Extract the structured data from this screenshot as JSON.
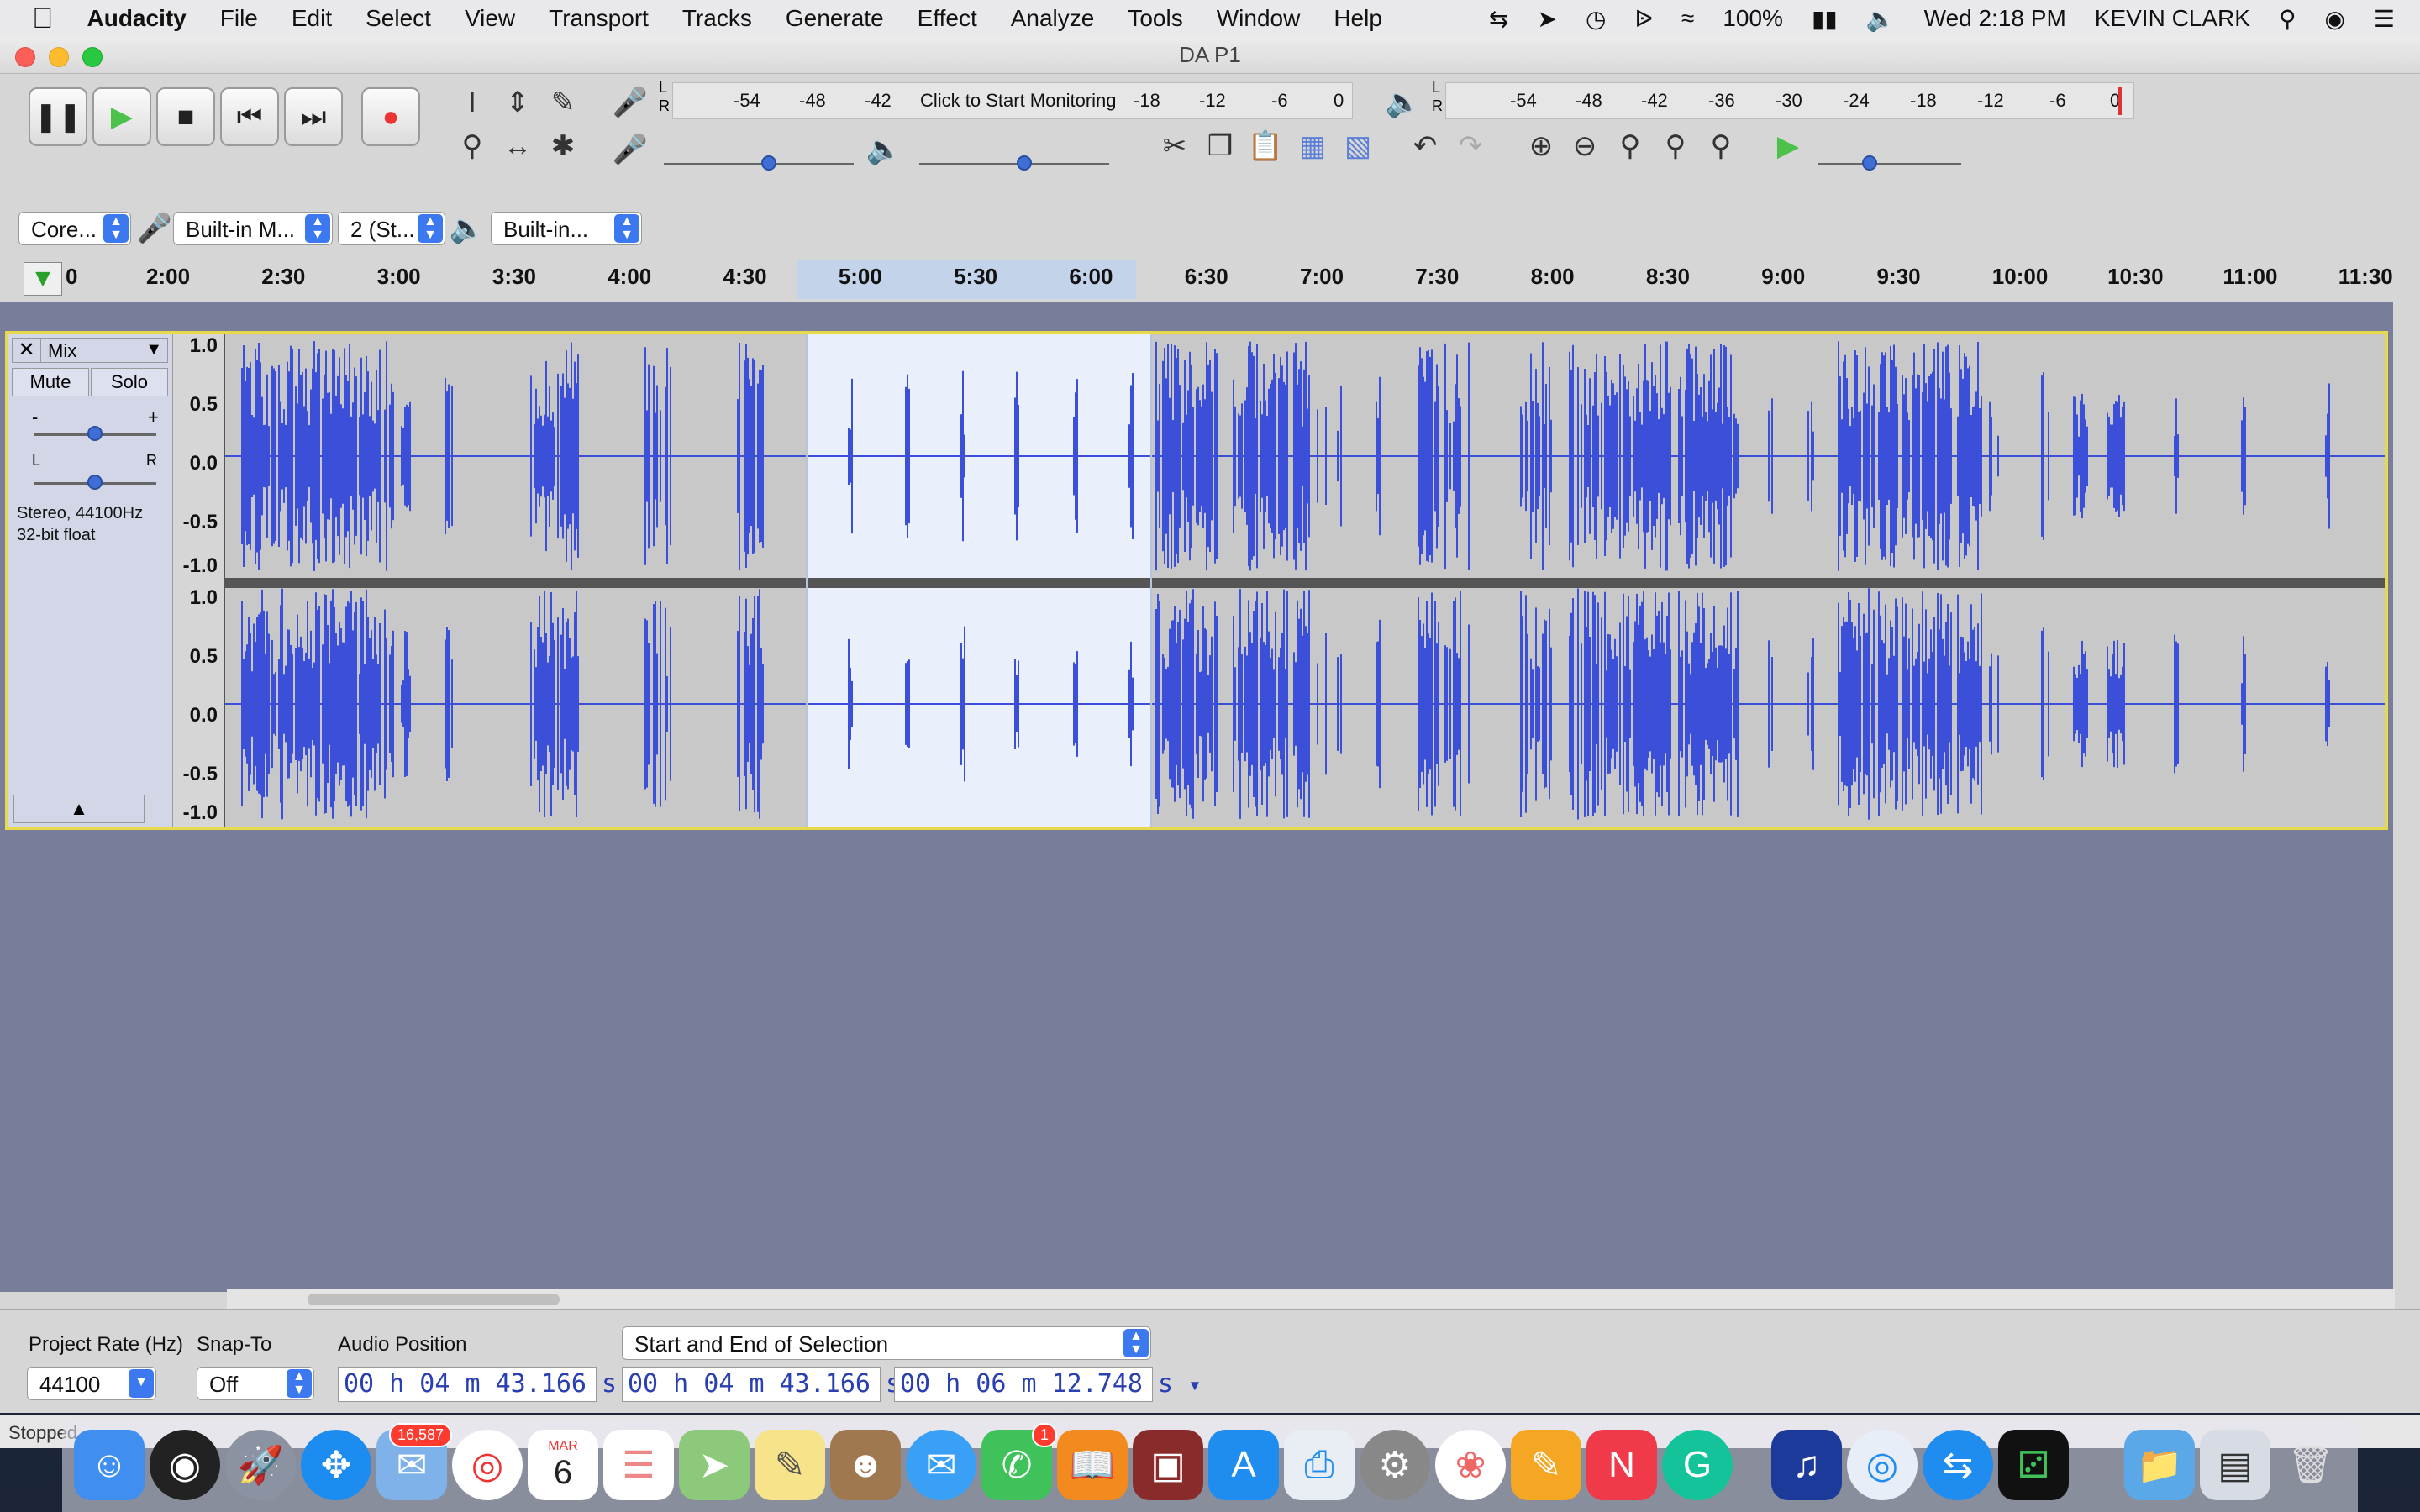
{
  "menubar": {
    "app": "Audacity",
    "items": [
      "File",
      "Edit",
      "Select",
      "View",
      "Transport",
      "Tracks",
      "Generate",
      "Effect",
      "Analyze",
      "Tools",
      "Window",
      "Help"
    ],
    "battery": "100%",
    "clock": "Wed 2:18 PM",
    "user": "KEVIN CLARK"
  },
  "window": {
    "title": "DA P1"
  },
  "meters": {
    "record_scale": [
      "-54",
      "-48",
      "-42",
      "-18",
      "-12",
      "-6",
      "0"
    ],
    "record_hint": "Click to Start Monitoring",
    "play_scale": [
      "-54",
      "-48",
      "-42",
      "-36",
      "-30",
      "-24",
      "-18",
      "-12",
      "-6",
      "0"
    ],
    "lr": [
      "L",
      "R"
    ]
  },
  "devices": {
    "host": "Core...",
    "input": "Built-in M...",
    "channels": "2 (St...",
    "output": "Built-in..."
  },
  "timeline": {
    "ticks": [
      "0",
      "2:00",
      "2:30",
      "3:00",
      "3:30",
      "4:00",
      "4:30",
      "5:00",
      "5:30",
      "6:00",
      "6:30",
      "7:00",
      "7:30",
      "8:00",
      "8:30",
      "9:00",
      "9:30",
      "10:00",
      "10:30",
      "11:00",
      "11:30"
    ]
  },
  "track": {
    "name": "Mix",
    "mute": "Mute",
    "solo": "Solo",
    "gain_minus": "-",
    "gain_plus": "+",
    "pan_l": "L",
    "pan_r": "R",
    "info_line1": "Stereo, 44100Hz",
    "info_line2": "32-bit float",
    "ruler_labels": [
      "1.0",
      "0.5",
      "0.0",
      "-0.5",
      "-1.0"
    ]
  },
  "selection_bar": {
    "rate_label": "Project Rate (Hz)",
    "rate_value": "44100",
    "snap_label": "Snap-To",
    "snap_value": "Off",
    "audio_pos_label": "Audio Position",
    "audio_pos": "00 h 04 m 43.166 s",
    "sel_mode": "Start and End of Selection",
    "sel_start": "00 h 04 m 43.166 s",
    "sel_end": "00 h 06 m 12.748 s"
  },
  "status": "Stopped.",
  "dock": {
    "mail_badge": "16,587",
    "calendar_month": "MAR",
    "calendar_day": "6",
    "facetime_badge": "1"
  },
  "colors": {
    "wave": "#3b4fd8",
    "selection": "#e9f0fb",
    "track_bg": "#c8c8c8",
    "border_focus": "#e6d94c"
  }
}
